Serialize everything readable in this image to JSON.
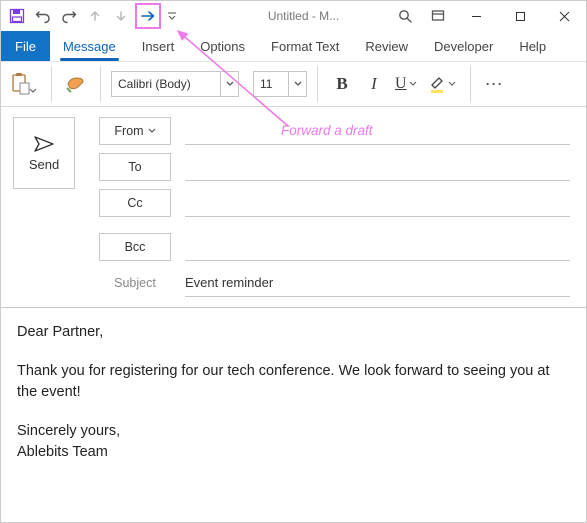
{
  "window": {
    "title": "Untitled  -  M..."
  },
  "tabs": {
    "file": "File",
    "message": "Message",
    "insert": "Insert",
    "options": "Options",
    "format": "Format Text",
    "review": "Review",
    "developer": "Developer",
    "help": "Help"
  },
  "ribbon": {
    "font_name": "Calibri (Body)",
    "font_size": "11",
    "bold": "B",
    "italic": "I",
    "underline": "U",
    "more": "⋯"
  },
  "compose": {
    "send": "Send",
    "from": "From",
    "to": "To",
    "cc": "Cc",
    "bcc": "Bcc",
    "subject_label": "Subject",
    "subject_value": "Event reminder",
    "from_value": "",
    "to_value": "",
    "cc_value": "",
    "bcc_value": ""
  },
  "body": {
    "greeting": "Dear Partner,",
    "para1": "Thank you for registering for our tech conference. We look forward to seeing you at the event!",
    "closing": "Sincerely yours,",
    "sig": "Ablebits Team"
  },
  "annotation": {
    "text": "Forward a draft"
  }
}
